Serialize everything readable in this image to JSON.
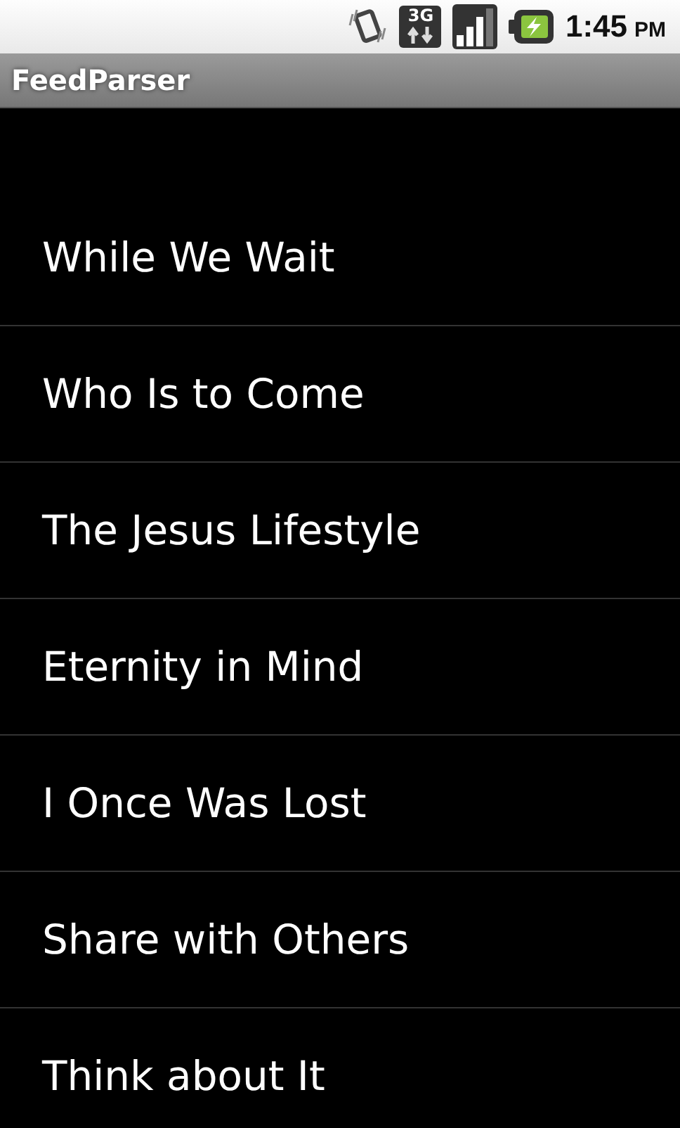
{
  "status_bar": {
    "network_type": "3G",
    "time": "1:45",
    "meridiem": "PM"
  },
  "app_bar": {
    "title": "FeedParser"
  },
  "list": {
    "items": [
      {
        "label": "While We Wait"
      },
      {
        "label": "Who Is to Come"
      },
      {
        "label": "The Jesus Lifestyle"
      },
      {
        "label": "Eternity in Mind"
      },
      {
        "label": "I Once Was Lost"
      },
      {
        "label": "Share with Others"
      },
      {
        "label": "Think about It"
      }
    ]
  }
}
